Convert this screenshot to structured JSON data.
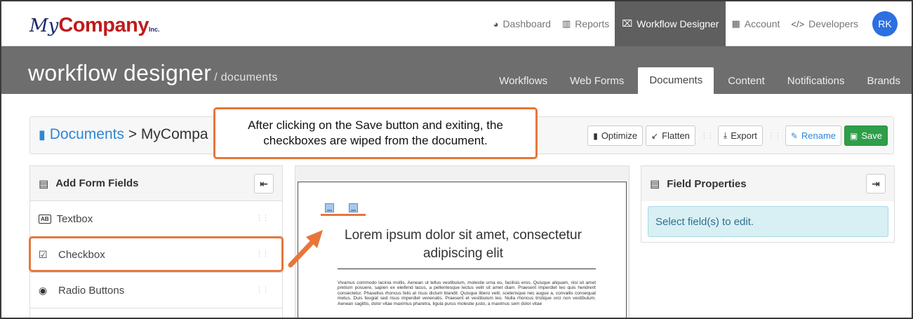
{
  "logo": {
    "my": "My",
    "company": "Company",
    "inc": "Inc."
  },
  "topnav": {
    "items": [
      {
        "label": "Dashboard",
        "icon": "dashboard-icon",
        "glyph": "◕"
      },
      {
        "label": "Reports",
        "icon": "reports-icon",
        "glyph": "▥"
      },
      {
        "label": "Workflow Designer",
        "icon": "workflow-icon",
        "glyph": "⌧"
      },
      {
        "label": "Account",
        "icon": "account-icon",
        "glyph": "▦"
      },
      {
        "label": "Developers",
        "icon": "code-icon",
        "glyph": "</>"
      }
    ],
    "active": "Workflow Designer",
    "avatar": "RK"
  },
  "band": {
    "title": "workflow designer",
    "subtitle": "/ documents",
    "tabs": [
      "Workflows",
      "Web Forms",
      "Documents",
      "Content",
      "Notifications",
      "Brands"
    ],
    "active_tab": "Documents"
  },
  "breadcrumb": {
    "root": "Documents",
    "separator": ">",
    "current": "MyCompa"
  },
  "toolbar": {
    "optimize": "Optimize",
    "flatten": "Flatten",
    "export": "Export",
    "rename": "Rename",
    "save": "Save"
  },
  "left_panel": {
    "title": "Add Form Fields",
    "fields": [
      {
        "label": "Textbox",
        "icon": "textbox-icon"
      },
      {
        "label": "Checkbox",
        "icon": "checkbox-icon"
      },
      {
        "label": "Radio Buttons",
        "icon": "radio-icon"
      }
    ]
  },
  "document": {
    "heading": "Lorem ipsum dolor sit amet, consectetur adipiscing elit",
    "body": "Vivamus commodo lacinia mollis. Aenean ut tellus vestibulum, molestie urna eu, facilisis eros. Quisque aliquam, nisi sit amet pretium posuere, sapien ex eleifend lacus, a pellentesque lectus velit sit amet diam. Praesent imperdiet leo quis hendrerit consectetur. Phasellus rhoncus felis at risus dictum blandit. Quisque libero velit, scelerisque nec augue a, convallis consequat metus. Duis feugiat sed risus imperdiet venenatis. Praesent et vestibulum leo. Nulla rhoncus tristique orci non vestibulum. Aenean sagittis, dolor vitae maximus pharetra, ligula purus molestie justo, a maximus sem dolor vitae"
  },
  "right_panel": {
    "title": "Field Properties",
    "message": "Select field(s) to edit."
  },
  "annotation": {
    "callout": "After clicking on the Save button and exiting, the checkboxes are wiped from the document.",
    "color": "#e8763a"
  },
  "colors": {
    "accent": "#2f86d6",
    "save": "#2e9e48",
    "band": "#6e6e6e",
    "avatar": "#2c6fe0"
  }
}
